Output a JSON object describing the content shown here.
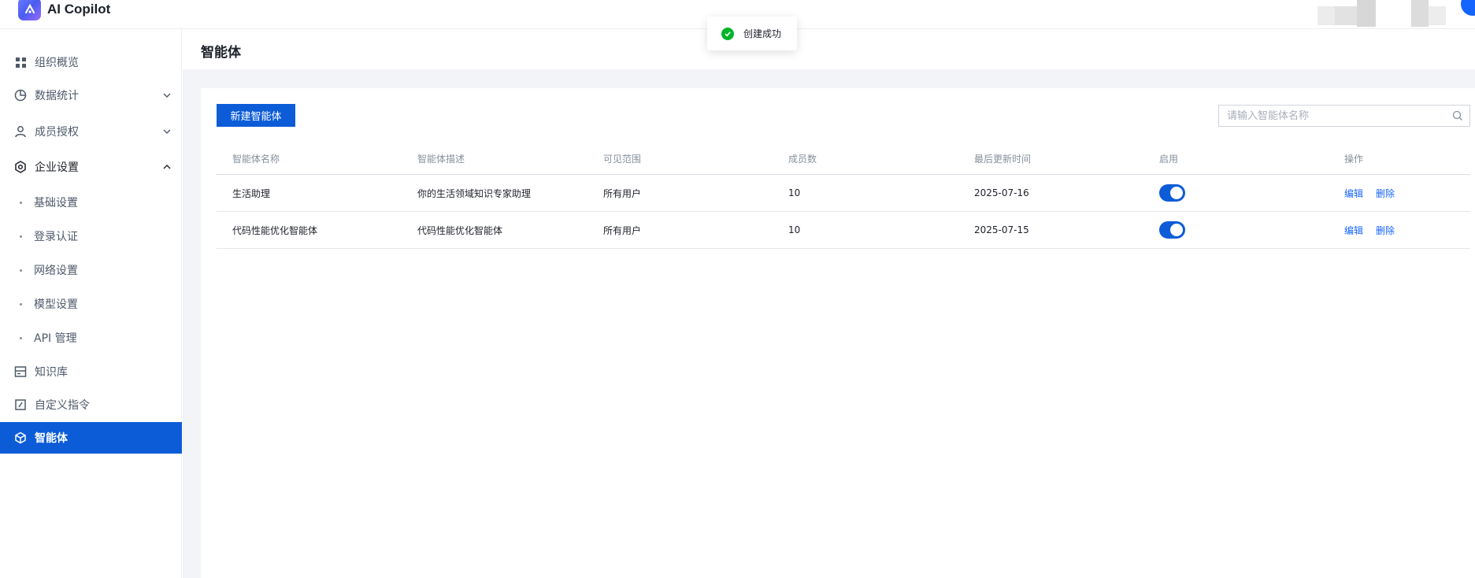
{
  "app": {
    "title": "AI Copilot"
  },
  "toast": {
    "message": "创建成功"
  },
  "sidebar": {
    "items": [
      {
        "label": "组织概览",
        "icon": "grid-icon"
      },
      {
        "label": "数据统计",
        "icon": "pie-chart-icon"
      },
      {
        "label": "成员授权",
        "icon": "user-icon"
      },
      {
        "label": "企业设置",
        "icon": "settings-icon"
      },
      {
        "label": "知识库",
        "icon": "database-icon"
      },
      {
        "label": "自定义指令",
        "icon": "command-icon"
      },
      {
        "label": "智能体",
        "icon": "cube-icon"
      }
    ],
    "sub_items": [
      {
        "label": "基础设置"
      },
      {
        "label": "登录认证"
      },
      {
        "label": "网络设置"
      },
      {
        "label": "模型设置"
      },
      {
        "label": "API 管理"
      }
    ]
  },
  "page": {
    "title": "智能体",
    "new_button": "新建智能体",
    "search_placeholder": "请输入智能体名称"
  },
  "table": {
    "headers": [
      "智能体名称",
      "智能体描述",
      "可见范围",
      "成员数",
      "最后更新时间",
      "启用",
      "操作"
    ],
    "rows": [
      {
        "name": "生活助理",
        "desc": "你的生活领域知识专家助理",
        "scope": "所有用户",
        "members": "10",
        "updated": "2025-07-16",
        "enabled": true,
        "edit": "编辑",
        "delete": "删除"
      },
      {
        "name": "代码性能优化智能体",
        "desc": "代码性能优化智能体",
        "scope": "所有用户",
        "members": "10",
        "updated": "2025-07-15",
        "enabled": true,
        "edit": "编辑",
        "delete": "删除"
      }
    ]
  },
  "colors": {
    "primary": "#0c5cd8",
    "link": "#1664ff",
    "success": "#00b42a"
  }
}
